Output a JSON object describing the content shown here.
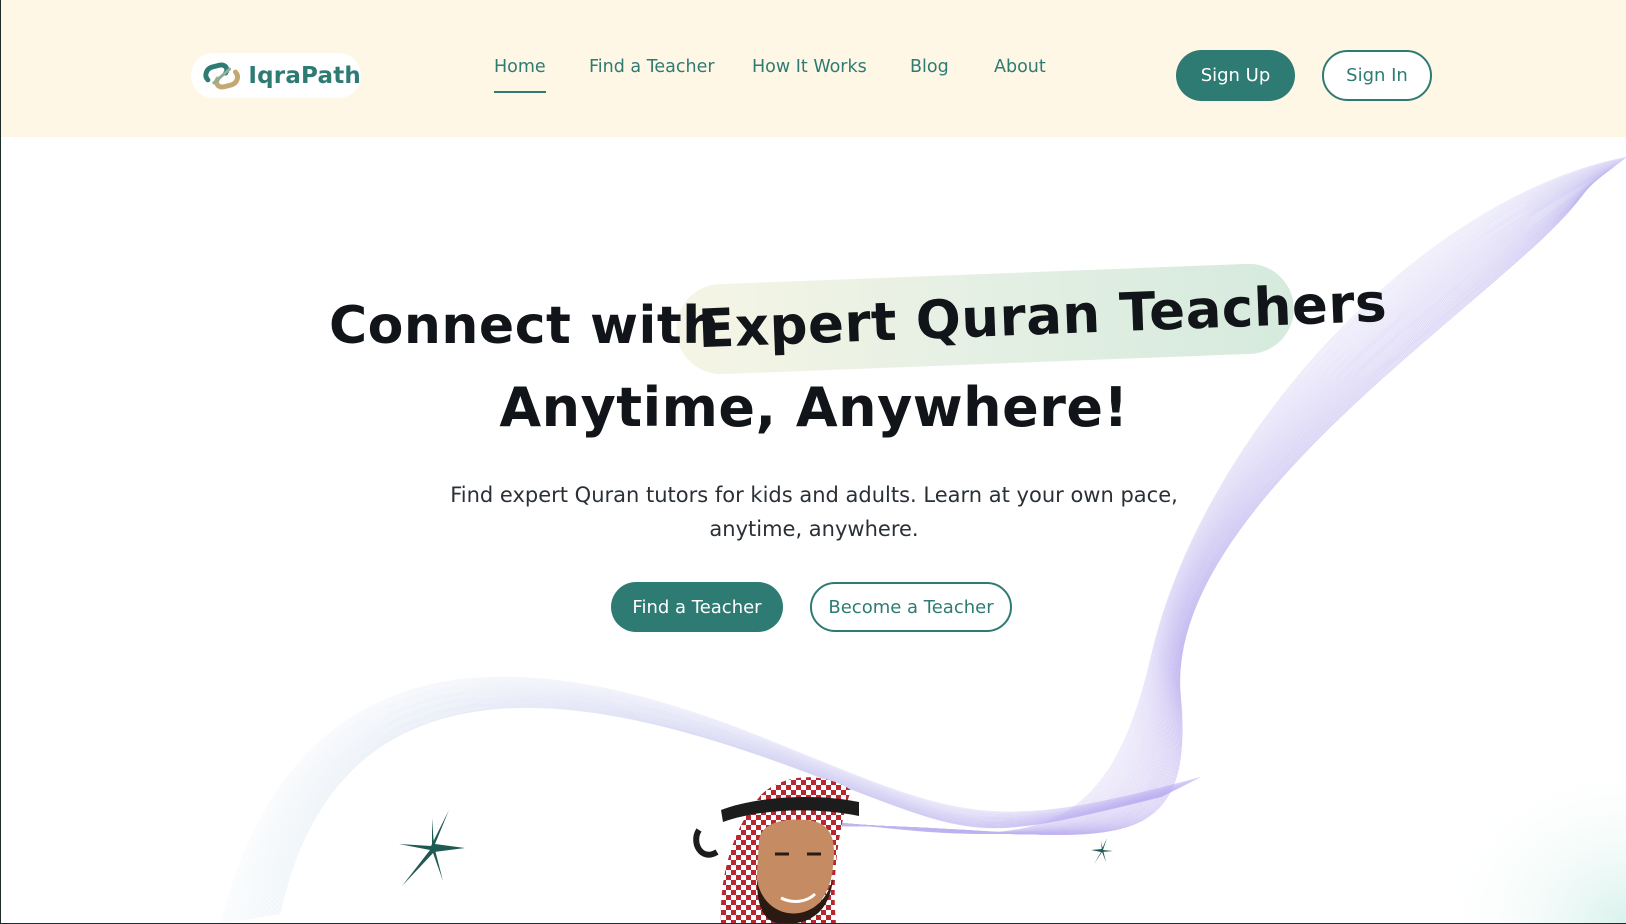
{
  "brand": {
    "name": "IqraPath"
  },
  "nav": {
    "items": [
      {
        "label": "Home",
        "active": true
      },
      {
        "label": "Find a Teacher",
        "active": false
      },
      {
        "label": "How It Works",
        "active": false
      },
      {
        "label": "Blog",
        "active": false
      },
      {
        "label": "About",
        "active": false
      }
    ]
  },
  "auth": {
    "signup_label": "Sign Up",
    "signin_label": "Sign In"
  },
  "hero": {
    "title_prefix": "Connect with",
    "title_highlight": "Expert Quran Teachers",
    "title_line2": "Anytime, Anywhere!",
    "subtitle": "Find expert Quran tutors for kids and adults. Learn at your own pace, anytime, anywhere.",
    "primary_cta": "Find a Teacher",
    "secondary_cta": "Become a Teacher"
  },
  "colors": {
    "brand_teal": "#2e7b73",
    "header_bg": "#fff7e6",
    "highlight_start": "#f6f5e5",
    "highlight_end": "#d5eadd",
    "line_violet": "#b7a6ef",
    "star_green": "#1f5a52"
  },
  "icons": {
    "logo": "intertwined-links-logo-icon",
    "sparkle": "sparkle-star-icon"
  }
}
